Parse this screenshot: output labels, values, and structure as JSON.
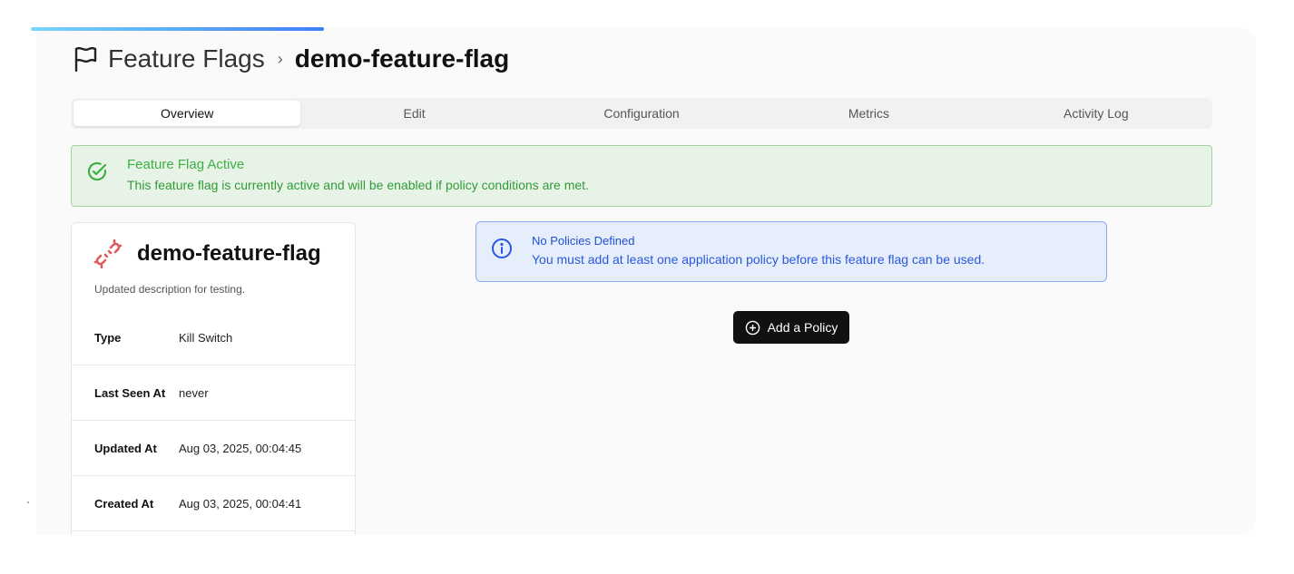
{
  "breadcrumb": {
    "parent": "Feature Flags",
    "separator": "›",
    "current": "demo-feature-flag"
  },
  "tabs": [
    {
      "label": "Overview",
      "active": true
    },
    {
      "label": "Edit",
      "active": false
    },
    {
      "label": "Configuration",
      "active": false
    },
    {
      "label": "Metrics",
      "active": false
    },
    {
      "label": "Activity Log",
      "active": false
    }
  ],
  "status_alert": {
    "title": "Feature Flag Active",
    "description": "This feature flag is currently active and will be enabled if policy conditions are met.",
    "icon": "check-circle-icon",
    "color": "#3cb043"
  },
  "flag_card": {
    "name": "demo-feature-flag",
    "description": "Updated description for testing.",
    "icon": "unlink-icon",
    "icon_color": "#e05a5a",
    "details": [
      {
        "label": "Type",
        "value": "Kill Switch"
      },
      {
        "label": "Last Seen At",
        "value": "never"
      },
      {
        "label": "Updated At",
        "value": "Aug 03, 2025, 00:04:45"
      },
      {
        "label": "Created At",
        "value": "Aug 03, 2025, 00:04:41"
      }
    ]
  },
  "policy_alert": {
    "title": "No Policies Defined",
    "description": "You must add at least one application policy before this feature flag can be used.",
    "icon": "info-circle-icon",
    "color": "#1e4fd8"
  },
  "add_policy_button": {
    "label": "Add a Policy",
    "icon": "plus-circle-icon"
  }
}
